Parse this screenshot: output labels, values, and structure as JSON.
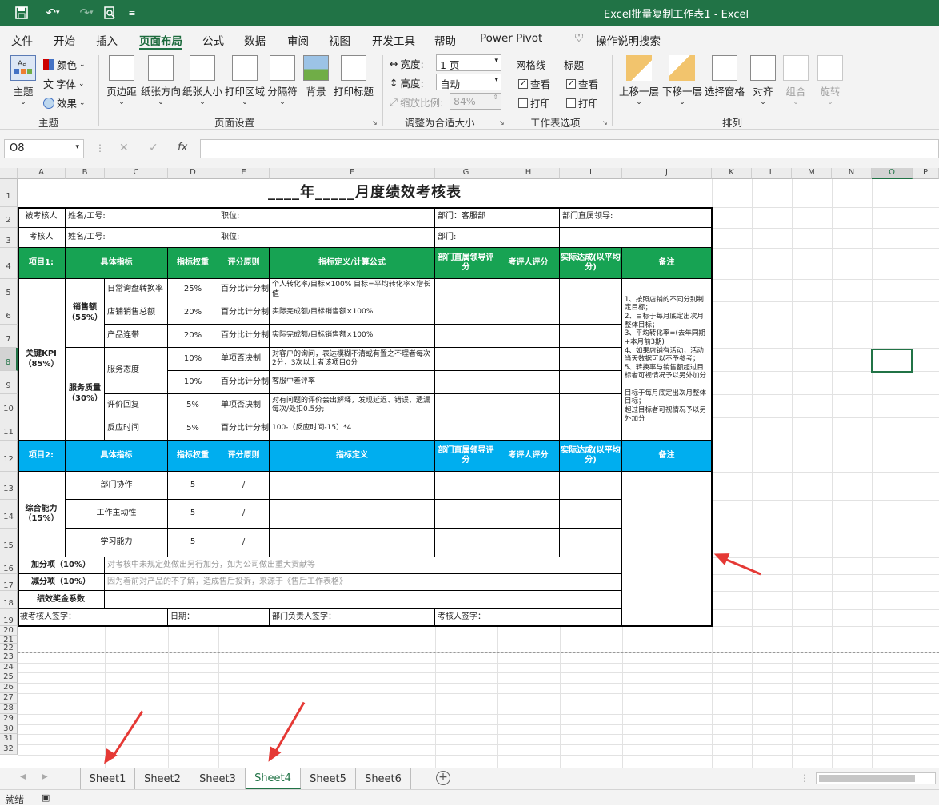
{
  "window": {
    "title": "Excel批量复制工作表1  -  Excel"
  },
  "menu": [
    "文件",
    "开始",
    "插入",
    "页面布局",
    "公式",
    "数据",
    "审阅",
    "视图",
    "开发工具",
    "帮助",
    "Power Pivot"
  ],
  "search_label": "操作说明搜索",
  "ribbon": {
    "theme": {
      "main": "主题",
      "colors": "颜色",
      "fonts": "字体",
      "effects": "效果",
      "group": "主题"
    },
    "page_setup": {
      "margins": "页边距",
      "orientation": "纸张方向",
      "size": "纸张大小",
      "print_area": "打印区域",
      "breaks": "分隔符",
      "background": "背景",
      "print_titles": "打印标题",
      "group": "页面设置"
    },
    "scale": {
      "width_label": "宽度:",
      "width_value": "1 页",
      "height_label": "高度:",
      "height_value": "自动",
      "scale_label": "缩放比例:",
      "scale_value": "84%",
      "group": "调整为合适大小"
    },
    "sheet_options": {
      "gridlines": "网格线",
      "headings": "标题",
      "view": "查看",
      "print": "打印",
      "group": "工作表选项"
    },
    "arrange": {
      "forward": "上移一层",
      "backward": "下移一层",
      "selection": "选择窗格",
      "align": "对齐",
      "group_btn": "组合",
      "rotate": "旋转",
      "group": "排列"
    }
  },
  "namebox": "O8",
  "columns": [
    "A",
    "B",
    "C",
    "D",
    "E",
    "F",
    "G",
    "H",
    "I",
    "J",
    "K",
    "L",
    "M",
    "N",
    "O",
    "P"
  ],
  "rows": [
    "1",
    "2",
    "3",
    "4",
    "5",
    "6",
    "7",
    "8",
    "9",
    "10",
    "11",
    "12",
    "13",
    "14",
    "15",
    "16",
    "17",
    "18",
    "19",
    "20",
    "21",
    "22",
    "23",
    "24",
    "25",
    "26",
    "27",
    "28",
    "29",
    "30",
    "31",
    "32"
  ],
  "form": {
    "title": "____年_____月度绩效考核表",
    "r2": {
      "a": "被考核人",
      "b": "姓名/工号:",
      "e": "职位:",
      "g": "部门：客服部",
      "i": "部门直属领导:"
    },
    "r3": {
      "a": "考核人",
      "b": "姓名/工号:",
      "e": "职位:",
      "g": "部门:"
    },
    "hdr1": {
      "a": "项目1:",
      "b": "具体指标",
      "d": "指标权重",
      "e": "评分原则",
      "f": "指标定义/计算公式",
      "g": "部门直属领导评分",
      "h": "考评人评分",
      "i": "实际达成(以平均分)",
      "j": "备注"
    },
    "kpi": "关键KPI（85%）",
    "sales": "销售额（55%）",
    "service": "服务质量（30%）",
    "items1": [
      {
        "c": "日常询盘转换率",
        "d": "25%",
        "e": "百分比计分制",
        "f": "个人转化率/目标×100%  目标=平均转化率×增长值"
      },
      {
        "c": "店铺销售总额",
        "d": "20%",
        "e": "百分比计分制",
        "f": "实际完成额/目标销售额×100%"
      },
      {
        "c": "产品连带",
        "d": "20%",
        "e": "百分比计分制",
        "f": "实际完成额/目标销售额×100%"
      },
      {
        "c": "服务态度",
        "d": "10%",
        "e": "单项否决制",
        "f": "对客户的询问，表达模糊不清或有置之不理者每次2分，3次以上者该项目0分"
      },
      {
        "c": "",
        "d": "10%",
        "e": "百分比计分制",
        "f": "客服中差评率"
      },
      {
        "c": "评价回复",
        "d": "5%",
        "e": "单项否决制",
        "f": "对有问题的评价会出解释，发现延迟、错误、遗漏每次/处扣0.5分;"
      },
      {
        "c": "反应时间",
        "d": "5%",
        "e": "百分比计分制",
        "f": "100-（反应时间-15）*4"
      }
    ],
    "remark1": "1、按照店铺的不同分别制定目标；\n2、目标于每月底定出次月整体目标；\n3、平均转化率=(去年同期+本月前3期)\n4、如果店铺有活动，活动当天数据可以不予参考；\n5、转换率与销售额超过目标者可视情况予以另外加分\n\n目标于每月底定出次月整体目标；\n超过目标者可视情况予以另外加分",
    "hdr2": {
      "a": "项目2:",
      "b": "具体指标",
      "d": "指标权重",
      "e": "评分原则",
      "f": "指标定义",
      "g": "部门直属领导评分",
      "h": "考评人评分",
      "i": "实际达成(以平均分)",
      "j": "备注"
    },
    "ability": "综合能力（15%）",
    "items2": [
      {
        "b": "部门协作",
        "d": "5",
        "e": "/"
      },
      {
        "b": "工作主动性",
        "d": "5",
        "e": "/"
      },
      {
        "b": "学习能力",
        "d": "5",
        "e": "/"
      }
    ],
    "bonus": {
      "label": "加分项（10%）",
      "text": "对考核中未规定处做出另行加分，如为公司做出重大贡献等"
    },
    "minus": {
      "label": "减分项（10%）",
      "text": "因为着前对产品的不了解，造成售后投诉，来源于《售后工作表格》"
    },
    "coef": {
      "label": "绩效奖金系数"
    },
    "sign": {
      "a": "被考核人签字：",
      "d": "日期：",
      "f": "部门负责人签字：",
      "g": "考核人签字："
    }
  },
  "sheets": [
    "Sheet1",
    "Sheet2",
    "Sheet3",
    "Sheet4",
    "Sheet5",
    "Sheet6"
  ],
  "active_sheet": "Sheet4",
  "status": "就绪"
}
